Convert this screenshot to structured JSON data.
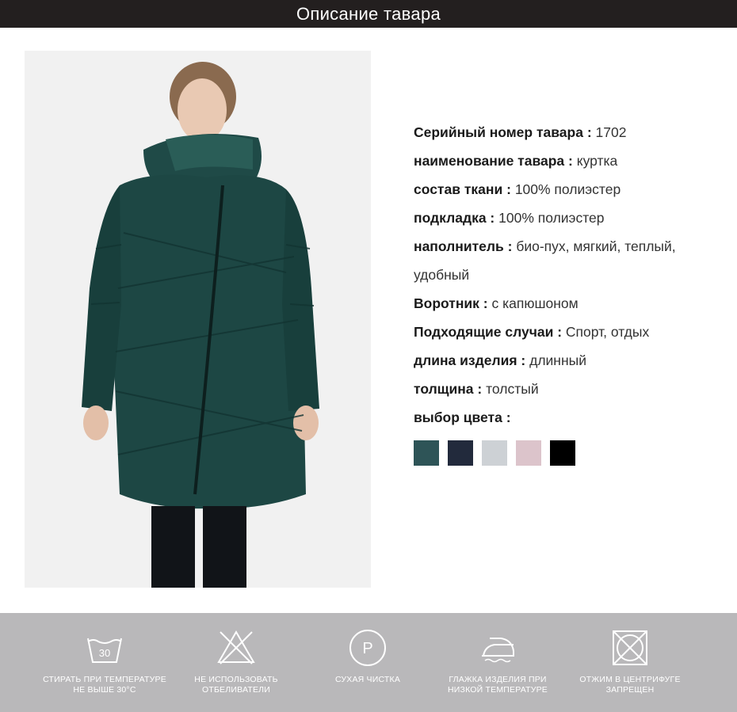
{
  "header": {
    "title": "Описание тавара"
  },
  "specs": [
    {
      "key": "Серийный номер тавара",
      "sep": " : ",
      "value": "1702"
    },
    {
      "key": "наименование тавара",
      "sep": " : ",
      "value": "куртка"
    },
    {
      "key": "состав ткани",
      "sep": " : ",
      "value": "100% полиэстер"
    },
    {
      "key": "подкладка",
      "sep": " : ",
      "value": "100% полиэстер"
    },
    {
      "key": "наполнитель",
      "sep": " : ",
      "value": "био-пух, мягкий, теплый, удобный"
    },
    {
      "key": "Воротник",
      "sep": " : ",
      "value": "с капюшоном"
    },
    {
      "key": "Подходящие случаи",
      "sep": " : ",
      "value": "Спорт, отдых"
    },
    {
      "key": "длина изделия",
      "sep": " : ",
      "value": "длинный"
    },
    {
      "key": "толщина",
      "sep": " : ",
      "value": "толстый"
    },
    {
      "key": "выбор цвета",
      "sep": " :",
      "value": ""
    }
  ],
  "swatches": [
    "#2e5457",
    "#222a3c",
    "#cdd1d5",
    "#dcc4cb",
    "#000000"
  ],
  "care": [
    {
      "icon": "wash-30-icon",
      "label": "СТИРАТЬ ПРИ ТЕМПЕРАТУРЕ\nНЕ ВЫШЕ 30°С",
      "badge": "30"
    },
    {
      "icon": "no-bleach-icon",
      "label": "НЕ ИСПОЛЬЗОВАТЬ\nОТБЕЛИВАТЕЛИ"
    },
    {
      "icon": "dry-clean-p-icon",
      "label": "СУХАЯ ЧИСТКА",
      "badge": "P"
    },
    {
      "icon": "iron-low-icon",
      "label": "ГЛАЖКА ИЗДЕЛИЯ ПРИ\nНИЗКОЙ ТЕМПЕРАТУРЕ"
    },
    {
      "icon": "no-tumble-dry-icon",
      "label": "ОТЖИМ В ЦЕНТРИФУГЕ\nЗАПРЕЩЕН"
    }
  ]
}
